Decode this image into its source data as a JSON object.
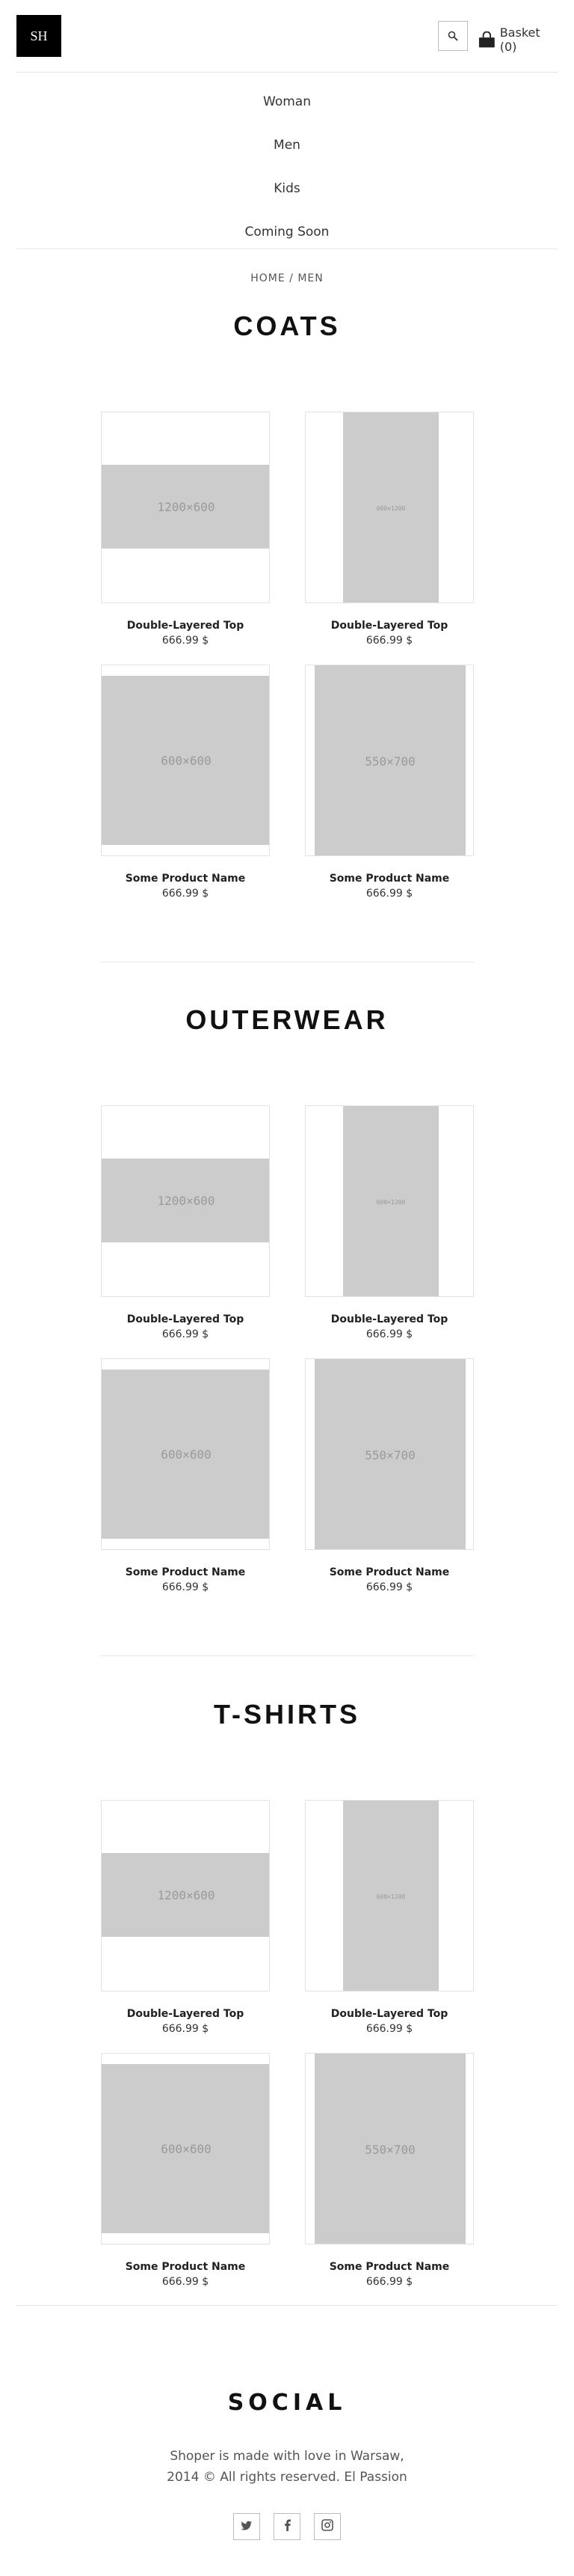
{
  "header": {
    "logo": "SH",
    "basket_label": "Basket (0)"
  },
  "nav": {
    "items": [
      {
        "label": "Woman"
      },
      {
        "label": "Men"
      },
      {
        "label": "Kids"
      },
      {
        "label": "Coming Soon"
      }
    ]
  },
  "breadcrumb": "HOME / MEN",
  "sections": [
    {
      "title": "COATS",
      "products": [
        {
          "name": "Double-Layered Top",
          "price": "666.99 $",
          "placeholder": "1200×600"
        },
        {
          "name": "Double-Layered Top",
          "price": "666.99 $",
          "placeholder": "600×1200"
        },
        {
          "name": "Some Product Name",
          "price": "666.99 $",
          "placeholder": "600×600"
        },
        {
          "name": "Some Product Name",
          "price": "666.99 $",
          "placeholder": "550×700"
        }
      ]
    },
    {
      "title": "OUTERWEAR",
      "products": [
        {
          "name": "Double-Layered Top",
          "price": "666.99 $",
          "placeholder": "1200×600"
        },
        {
          "name": "Double-Layered Top",
          "price": "666.99 $",
          "placeholder": "600×1200"
        },
        {
          "name": "Some Product Name",
          "price": "666.99 $",
          "placeholder": "600×600"
        },
        {
          "name": "Some Product Name",
          "price": "666.99 $",
          "placeholder": "550×700"
        }
      ]
    },
    {
      "title": "T-SHIRTS",
      "products": [
        {
          "name": "Double-Layered Top",
          "price": "666.99 $",
          "placeholder": "1200×600"
        },
        {
          "name": "Double-Layered Top",
          "price": "666.99 $",
          "placeholder": "600×1200"
        },
        {
          "name": "Some Product Name",
          "price": "666.99 $",
          "placeholder": "600×600"
        },
        {
          "name": "Some Product Name",
          "price": "666.99 $",
          "placeholder": "550×700"
        }
      ]
    }
  ],
  "footer": {
    "title": "SOCIAL",
    "line1": "Shoper is made with love in Warsaw,",
    "line2": "2014 © All rights reserved. El Passion",
    "social": [
      {
        "icon": "twitter-icon",
        "glyph": "t"
      },
      {
        "icon": "facebook-icon",
        "glyph": "f"
      },
      {
        "icon": "instagram-icon",
        "glyph": "◎"
      }
    ]
  },
  "colors": {
    "placeholder": "#cccccc",
    "placeholder_text": "#9a9a9a",
    "logo_bg": "#000000",
    "border": "#e3e3e3"
  }
}
